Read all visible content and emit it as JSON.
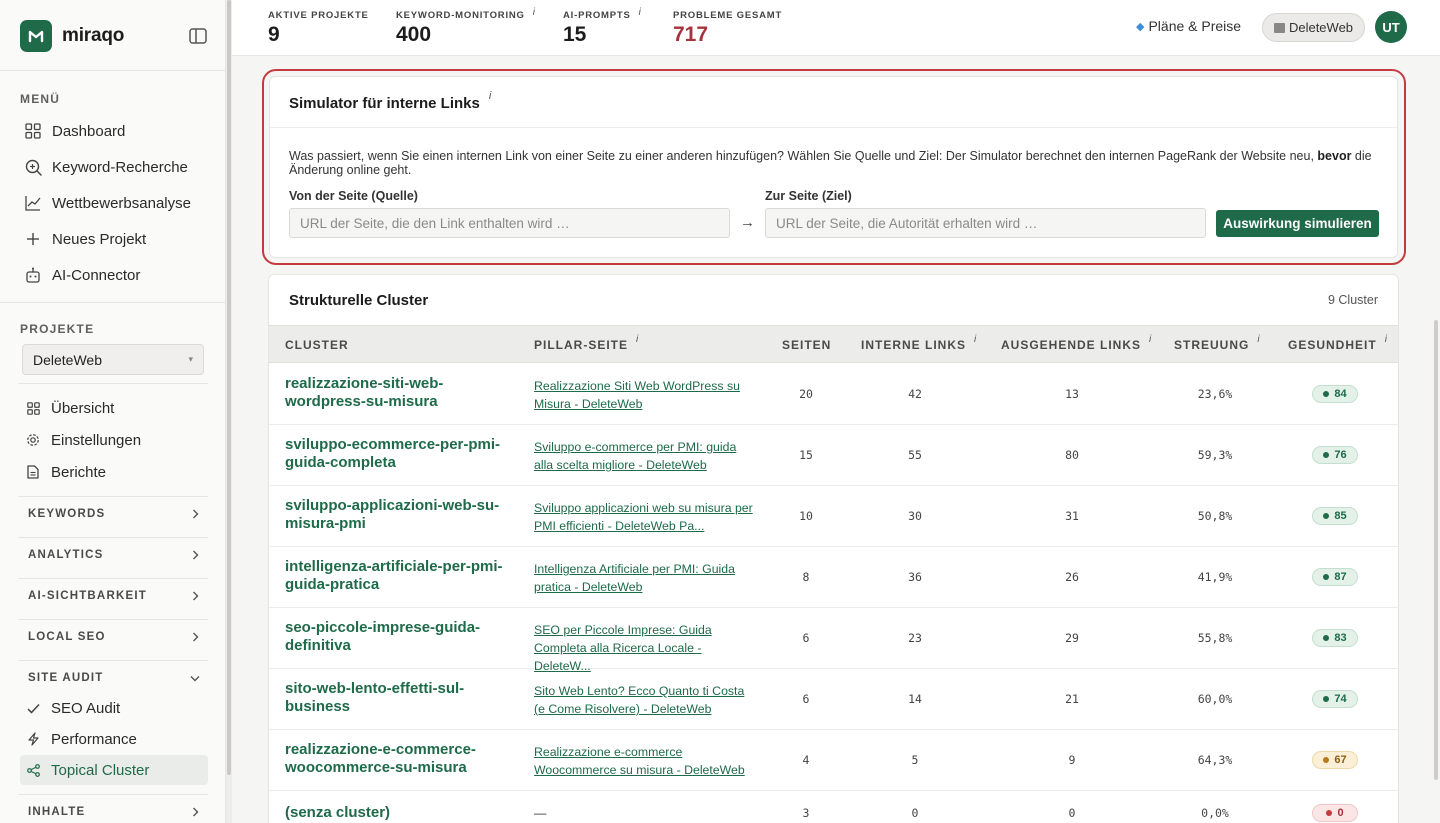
{
  "brand": {
    "name": "miraqo"
  },
  "sidebar": {
    "menu_heading": "MENÜ",
    "menu": [
      {
        "label": "Dashboard",
        "icon": "grid-icon"
      },
      {
        "label": "Keyword-Recherche",
        "icon": "search-icon"
      },
      {
        "label": "Wettbewerbsanalyse",
        "icon": "chart-line-icon"
      },
      {
        "label": "Neues Projekt",
        "icon": "plus-icon"
      },
      {
        "label": "AI-Connector",
        "icon": "robot-icon"
      }
    ],
    "projects_heading": "PROJEKTE",
    "project_select": "DeleteWeb",
    "project_nav": [
      {
        "label": "Übersicht",
        "icon": "grid-icon"
      },
      {
        "label": "Einstellungen",
        "icon": "gear-icon"
      },
      {
        "label": "Berichte",
        "icon": "document-icon"
      }
    ],
    "sections": [
      {
        "label": "KEYWORDS",
        "expanded": false
      },
      {
        "label": "ANALYTICS",
        "expanded": false
      },
      {
        "label": "AI-SICHTBARKEIT",
        "expanded": false
      },
      {
        "label": "LOCAL SEO",
        "expanded": false
      },
      {
        "label": "SITE AUDIT",
        "expanded": true
      },
      {
        "label": "INHALTE",
        "expanded": false
      }
    ],
    "site_audit_items": [
      {
        "label": "SEO Audit",
        "icon": "check-icon"
      },
      {
        "label": "Performance",
        "icon": "bolt-icon"
      },
      {
        "label": "Topical Cluster",
        "icon": "share-nodes-icon",
        "active": true
      }
    ]
  },
  "topbar": {
    "stats": [
      {
        "label": "AKTIVE PROJEKTE",
        "value": "9",
        "info": false
      },
      {
        "label": "KEYWORD-MONITORING",
        "value": "400",
        "info": true
      },
      {
        "label": "AI-PROMPTS",
        "value": "15",
        "info": true
      },
      {
        "label": "PROBLEME GESAMT",
        "value": "717",
        "info": false
      }
    ],
    "plans_label": "Pläne & Preise",
    "workspace_label": "DeleteWeb",
    "avatar_initials": "UT",
    "info_glyph": "i"
  },
  "simulator": {
    "title": "Simulator für interne Links",
    "description_pre": "Was passiert, wenn Sie einen internen Link von einer Seite zu einer anderen hinzufügen? Wählen Sie Quelle und Ziel: Der Simulator berechnet den internen PageRank der Website neu, ",
    "description_bold": "bevor",
    "description_post": " die Änderung online geht.",
    "source_label": "Von der Seite (Quelle)",
    "source_placeholder": "URL der Seite, die den Link enthalten wird …",
    "target_label": "Zur Seite (Ziel)",
    "target_placeholder": "URL der Seite, die Autorität erhalten wird …",
    "button_label": "Auswirkung simulieren",
    "arrow": "→"
  },
  "clusters": {
    "title": "Strukturelle Cluster",
    "count_label": "9 Cluster",
    "columns": {
      "cluster": "CLUSTER",
      "pillar": "PILLAR-SEITE",
      "pages": "SEITEN",
      "internal": "INTERNE LINKS",
      "outgoing": "AUSGEHENDE LINKS",
      "spread": "STREUUNG",
      "health": "GESUNDHEIT"
    },
    "rows": [
      {
        "name": "realizzazione-siti-web-wordpress-su-misura",
        "pillar": "Realizzazione Siti Web WordPress su Misura - DeleteWeb",
        "pages": "20",
        "internal": "42",
        "outgoing": "13",
        "spread": "23,6%",
        "health": "84",
        "status": "good"
      },
      {
        "name": "sviluppo-ecommerce-per-pmi-guida-completa",
        "pillar": "Sviluppo e-commerce per PMI: guida alla scelta migliore - DeleteWeb",
        "pages": "15",
        "internal": "55",
        "outgoing": "80",
        "spread": "59,3%",
        "health": "76",
        "status": "good"
      },
      {
        "name": "sviluppo-applicazioni-web-su-misura-pmi",
        "pillar": "Sviluppo applicazioni web su misura per PMI efficienti - DeleteWeb Pa...",
        "pages": "10",
        "internal": "30",
        "outgoing": "31",
        "spread": "50,8%",
        "health": "85",
        "status": "good"
      },
      {
        "name": "intelligenza-artificiale-per-pmi-guida-pratica",
        "pillar": "Intelligenza Artificiale per PMI: Guida pratica - DeleteWeb",
        "pages": "8",
        "internal": "36",
        "outgoing": "26",
        "spread": "41,9%",
        "health": "87",
        "status": "good"
      },
      {
        "name": "seo-piccole-imprese-guida-definitiva",
        "pillar": "SEO per Piccole Imprese: Guida Completa alla Ricerca Locale - DeleteW...",
        "pages": "6",
        "internal": "23",
        "outgoing": "29",
        "spread": "55,8%",
        "health": "83",
        "status": "good"
      },
      {
        "name": "sito-web-lento-effetti-sul-business",
        "pillar": "Sito Web Lento? Ecco Quanto ti Costa (e Come Risolvere) - DeleteWeb",
        "pages": "6",
        "internal": "14",
        "outgoing": "21",
        "spread": "60,0%",
        "health": "74",
        "status": "good"
      },
      {
        "name": "realizzazione-e-commerce-woocommerce-su-misura",
        "pillar": "Realizzazione e-commerce Woocommerce su misura - DeleteWeb",
        "pages": "4",
        "internal": "5",
        "outgoing": "9",
        "spread": "64,3%",
        "health": "67",
        "status": "warn"
      },
      {
        "name": "(senza cluster)",
        "pillar": "—",
        "pages": "3",
        "internal": "0",
        "outgoing": "0",
        "spread": "0,0%",
        "health": "0",
        "status": "bad"
      }
    ]
  },
  "colors": {
    "brand_green": "#1e6a49",
    "alert_red": "#a8323b",
    "highlight_outline": "#c53a40",
    "warn_amber": "#b7791f"
  }
}
